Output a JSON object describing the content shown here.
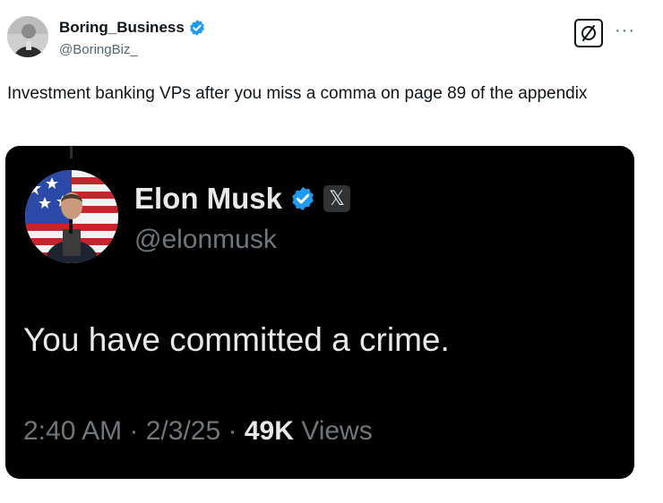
{
  "tweet": {
    "author_name": "Boring_Business",
    "author_handle": "@BoringBiz_",
    "text": "Investment banking VPs after you miss a comma on page 89 of the appendix",
    "more_label": "···"
  },
  "quoted": {
    "name": "Elon Musk",
    "handle": "@elonmusk",
    "affiliate_badge": "𝕏",
    "text": "You have committed a crime.",
    "time": "2:40 AM",
    "sep1": " · ",
    "date": "2/3/25",
    "sep2": " · ",
    "views_count": "49K",
    "views_label": " Views"
  },
  "icons": {
    "verified": "verified-badge-icon",
    "grok": "grok-icon",
    "more": "more-icon",
    "x_logo": "x-logo-icon"
  },
  "colors": {
    "verified_blue": "#1d9bf0",
    "text_primary": "#0f1419",
    "text_secondary": "#536471",
    "card_bg": "#000000",
    "card_text": "#e7e9ea",
    "card_secondary": "#71767b"
  }
}
